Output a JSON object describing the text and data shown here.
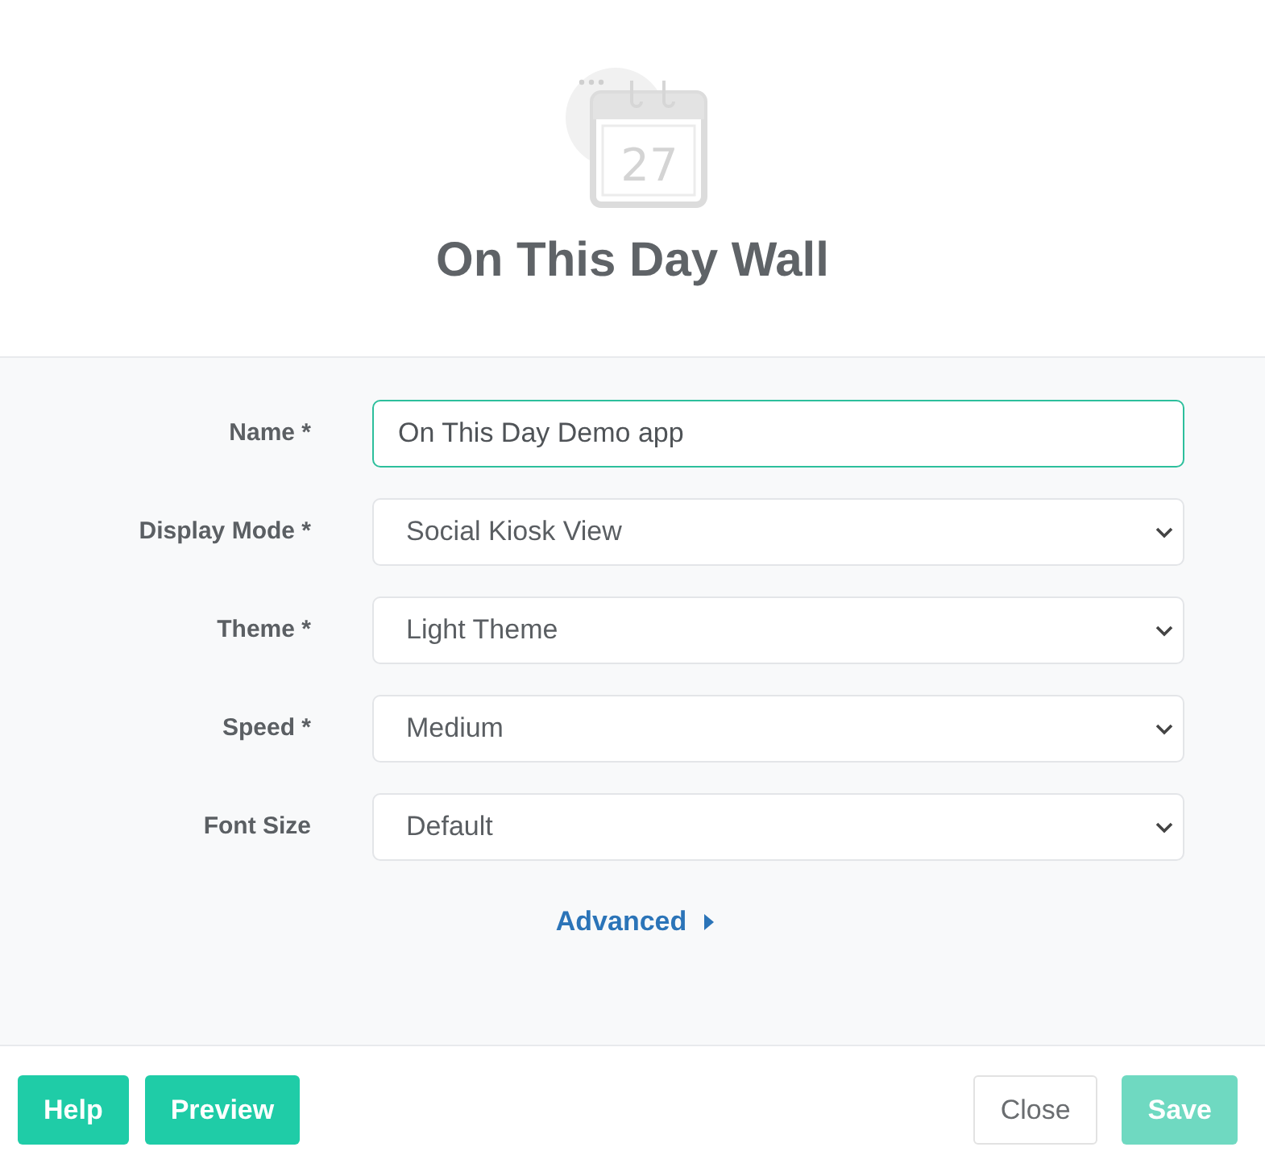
{
  "header": {
    "day": "27",
    "title": "On This Day Wall"
  },
  "fields": [
    {
      "label": "Name *",
      "kind": "text",
      "value": "On This Day Demo app",
      "focused": true
    },
    {
      "label": "Display Mode *",
      "kind": "select",
      "value": "Social Kiosk View",
      "focused": false
    },
    {
      "label": "Theme *",
      "kind": "select",
      "value": "Light Theme",
      "focused": false
    },
    {
      "label": "Speed *",
      "kind": "select",
      "value": "Medium",
      "focused": false
    },
    {
      "label": "Font Size",
      "kind": "select",
      "value": "Default",
      "focused": false
    }
  ],
  "advanced": {
    "label": "Advanced",
    "expanded": false
  },
  "footer": {
    "left_buttons": [
      {
        "label": "Help",
        "kind": "primary",
        "disabled": false
      },
      {
        "label": "Preview",
        "kind": "primary",
        "disabled": false
      }
    ],
    "right_buttons": [
      {
        "label": "Close",
        "kind": "default",
        "disabled": false
      },
      {
        "label": "Save",
        "kind": "primary",
        "disabled": true
      }
    ]
  }
}
